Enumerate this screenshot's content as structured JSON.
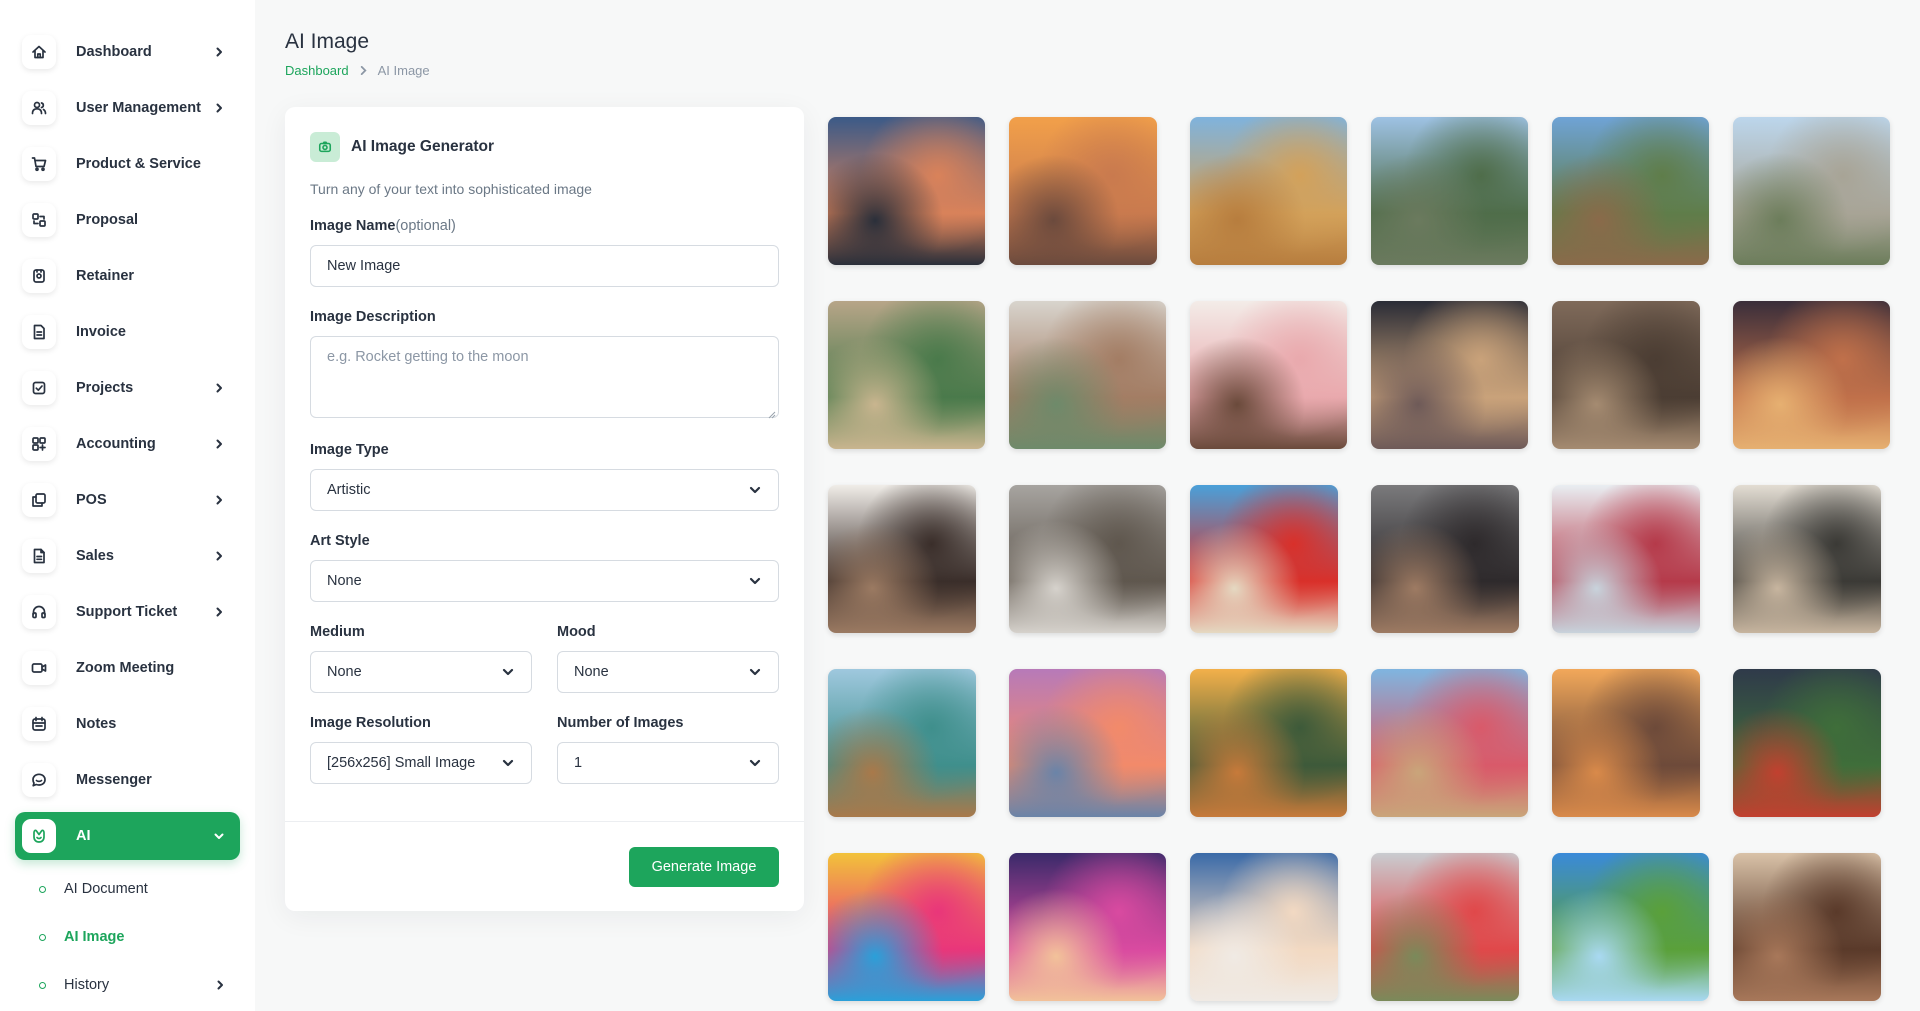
{
  "sidebar": {
    "items": [
      {
        "label": "Dashboard",
        "icon": "home-icon",
        "has_children": true
      },
      {
        "label": "User Management",
        "icon": "users-icon",
        "has_children": true
      },
      {
        "label": "Product & Service",
        "icon": "cart-icon",
        "has_children": false
      },
      {
        "label": "Proposal",
        "icon": "proposal-icon",
        "has_children": false
      },
      {
        "label": "Retainer",
        "icon": "retainer-icon",
        "has_children": false
      },
      {
        "label": "Invoice",
        "icon": "invoice-icon",
        "has_children": false
      },
      {
        "label": "Projects",
        "icon": "checklist-icon",
        "has_children": true
      },
      {
        "label": "Accounting",
        "icon": "grid-plus-icon",
        "has_children": true
      },
      {
        "label": "POS",
        "icon": "layers-icon",
        "has_children": true
      },
      {
        "label": "Sales",
        "icon": "file-icon",
        "has_children": true
      },
      {
        "label": "Support Ticket",
        "icon": "headset-icon",
        "has_children": true
      },
      {
        "label": "Zoom Meeting",
        "icon": "video-icon",
        "has_children": false
      },
      {
        "label": "Notes",
        "icon": "calendar-note-icon",
        "has_children": false
      },
      {
        "label": "Messenger",
        "icon": "chat-icon",
        "has_children": false
      },
      {
        "label": "AI",
        "icon": "ai-icon",
        "has_children": true,
        "active": true
      }
    ],
    "ai_sub_items": [
      {
        "label": "AI Document",
        "current": false,
        "has_children": false
      },
      {
        "label": "AI Image",
        "current": true,
        "has_children": false
      },
      {
        "label": "History",
        "current": false,
        "has_children": true
      }
    ]
  },
  "header": {
    "title": "AI Image",
    "breadcrumb": {
      "home": "Dashboard",
      "current": "AI Image"
    }
  },
  "generator": {
    "title": "AI Image Generator",
    "subtitle": "Turn any of your text into sophisticated image",
    "image_name_label": "Image Name",
    "image_name_optional": "(optional)",
    "image_name_value": "New Image",
    "description_label": "Image Description",
    "description_placeholder": "e.g. Rocket getting to the moon",
    "image_type_label": "Image Type",
    "image_type_value": "Artistic",
    "art_style_label": "Art Style",
    "art_style_value": "None",
    "medium_label": "Medium",
    "medium_value": "None",
    "mood_label": "Mood",
    "mood_value": "None",
    "resolution_label": "Image Resolution",
    "resolution_value": "[256x256] Small Image",
    "count_label": "Number of Images",
    "count_value": "1",
    "generate_label": "Generate Image"
  },
  "gallery": {
    "rows": [
      [
        {
          "name": "gallery-image-new-york",
          "colors": [
            "#3b5a88",
            "#d9825a",
            "#2a2f3a"
          ]
        },
        {
          "name": "gallery-image-taj-mahal",
          "colors": [
            "#f2a04a",
            "#c97a4e",
            "#6b4a3d"
          ]
        },
        {
          "name": "gallery-image-pyramids",
          "colors": [
            "#7fb3dd",
            "#d3a15a",
            "#b77d3e"
          ]
        },
        {
          "name": "gallery-image-machu-picchu",
          "colors": [
            "#9ec2e4",
            "#4f6d4a",
            "#6b7a5e"
          ]
        },
        {
          "name": "gallery-image-great-wall",
          "colors": [
            "#6fa3d6",
            "#5f7d4a",
            "#8a6a4a"
          ]
        },
        {
          "name": "gallery-image-world-landmarks",
          "colors": [
            "#bcd6ec",
            "#a8a496",
            "#6c7d5b"
          ]
        }
      ],
      [
        {
          "name": "gallery-image-child-playing",
          "colors": [
            "#b7a588",
            "#4a7a4b",
            "#c9b58f"
          ]
        },
        {
          "name": "gallery-image-family-hug",
          "colors": [
            "#d8d4cd",
            "#a37d64",
            "#6e8a6a"
          ]
        },
        {
          "name": "gallery-image-pink-cake",
          "colors": [
            "#f3ece8",
            "#e9a9ad",
            "#6a4a3b"
          ]
        },
        {
          "name": "gallery-image-sparklers",
          "colors": [
            "#2a2c36",
            "#c9a27a",
            "#6e5a58"
          ]
        },
        {
          "name": "gallery-image-woman-sitting",
          "colors": [
            "#7f6a5a",
            "#4b3d33",
            "#a58b71"
          ]
        },
        {
          "name": "gallery-image-party-friends",
          "colors": [
            "#3a2e3a",
            "#c0704a",
            "#e6b071"
          ]
        }
      ],
      [
        {
          "name": "gallery-image-laughing-women",
          "colors": [
            "#f0ede8",
            "#3a2e2a",
            "#9b7a62"
          ]
        },
        {
          "name": "gallery-image-wedding-couple",
          "colors": [
            "#a7a4a0",
            "#5f574e",
            "#d6d2cc"
          ]
        },
        {
          "name": "gallery-image-beach-scarf",
          "colors": [
            "#4aa0d9",
            "#d9302a",
            "#e5d9c2"
          ]
        },
        {
          "name": "gallery-image-dancing-woman",
          "colors": [
            "#7a7a7c",
            "#2e2a2c",
            "#9e7b63"
          ]
        },
        {
          "name": "gallery-image-heart-wreath",
          "colors": [
            "#e9eef2",
            "#b53a4a",
            "#c8d3dc"
          ]
        },
        {
          "name": "gallery-image-rocky-shore",
          "colors": [
            "#e3ddd3",
            "#3b3a36",
            "#c7b59f"
          ]
        }
      ],
      [
        {
          "name": "gallery-image-tropical-beach",
          "colors": [
            "#9fc8de",
            "#3f8f8c",
            "#a9794a"
          ]
        },
        {
          "name": "gallery-image-sunset-pier",
          "colors": [
            "#b77ab9",
            "#f28a6a",
            "#6a84a8"
          ]
        },
        {
          "name": "gallery-image-palm-sunset",
          "colors": [
            "#f3b04a",
            "#3d5a3a",
            "#c77a3a"
          ]
        },
        {
          "name": "gallery-image-crowded-beach",
          "colors": [
            "#7fb5e0",
            "#d95a6a",
            "#c9a57a"
          ]
        },
        {
          "name": "gallery-image-butterfly-jar",
          "colors": [
            "#f2a85a",
            "#6d4a3a",
            "#d98a4a"
          ]
        },
        {
          "name": "gallery-image-lone-tree",
          "colors": [
            "#2f3a4a",
            "#3f6e3a",
            "#c2402f"
          ]
        }
      ],
      [
        {
          "name": "gallery-image-holi-colors",
          "colors": [
            "#f2c23a",
            "#e9367a",
            "#2aa0d9"
          ]
        },
        {
          "name": "gallery-image-stage-performance",
          "colors": [
            "#3a2a6a",
            "#d94aa0",
            "#f2c29a"
          ]
        },
        {
          "name": "gallery-image-flower-girl",
          "colors": [
            "#3a6aa8",
            "#f2d9c2",
            "#f0eae4"
          ]
        },
        {
          "name": "gallery-image-rose-bouquet",
          "colors": [
            "#c9ccd0",
            "#e0484a",
            "#7a8a5a"
          ]
        },
        {
          "name": "gallery-image-green-field",
          "colors": [
            "#3a8ad9",
            "#5aa03a",
            "#a9d9f2"
          ]
        },
        {
          "name": "gallery-image-guitar-van",
          "colors": [
            "#d9c2a8",
            "#5a3a2a",
            "#a8785a"
          ]
        }
      ]
    ]
  }
}
